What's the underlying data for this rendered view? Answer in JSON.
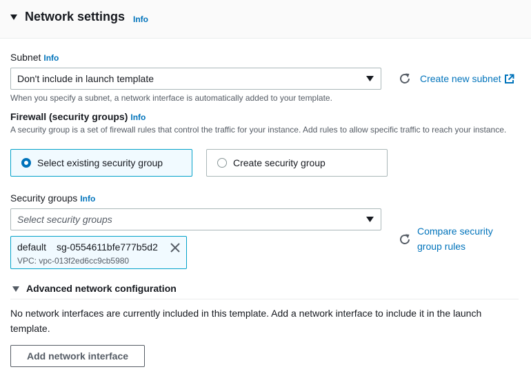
{
  "header": {
    "title": "Network settings",
    "info": "Info"
  },
  "subnet": {
    "label": "Subnet",
    "info": "Info",
    "value": "Don't include in launch template",
    "create_link": "Create new subnet",
    "description": "When you specify a subnet, a network interface is automatically added to your template."
  },
  "firewall": {
    "label": "Firewall (security groups)",
    "info": "Info",
    "description": "A security group is a set of firewall rules that control the traffic for your instance. Add rules to allow specific traffic to reach your instance.",
    "options": [
      {
        "label": "Select existing security group",
        "selected": true
      },
      {
        "label": "Create security group",
        "selected": false
      }
    ]
  },
  "security_groups": {
    "label": "Security groups",
    "info": "Info",
    "placeholder": "Select security groups",
    "compare_link_line1": "Compare security",
    "compare_link_line2": "group rules",
    "tokens": [
      {
        "name": "default",
        "id": "sg-0554611bfe777b5d2",
        "vpc": "VPC: vpc-013f2ed6cc9cb5980"
      }
    ]
  },
  "advanced": {
    "title": "Advanced network configuration",
    "message": "No network interfaces are currently included in this template. Add a network interface to include it in the launch template.",
    "add_button": "Add network interface"
  },
  "colors": {
    "link": "#0073bb",
    "selected_border": "#00a1c9",
    "selected_bg": "#f1faff"
  }
}
